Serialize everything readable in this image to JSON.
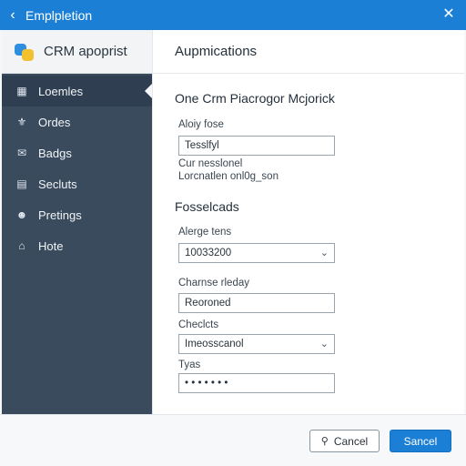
{
  "window": {
    "title": "Emplpletion",
    "back_icon": "chevron-left-icon",
    "close_icon": "close-icon"
  },
  "sidebar": {
    "brand": "CRM apoprist",
    "items": [
      {
        "label": "Loemles",
        "icon": "calendar-icon",
        "active": true
      },
      {
        "label": "Ordes",
        "icon": "flask-icon",
        "active": false
      },
      {
        "label": "Badgs",
        "icon": "mail-icon",
        "active": false
      },
      {
        "label": "Secluts",
        "icon": "document-icon",
        "active": false
      },
      {
        "label": "Pretings",
        "icon": "user-icon",
        "active": false
      },
      {
        "label": "Hote",
        "icon": "home-icon",
        "active": false
      }
    ]
  },
  "main": {
    "header": "Aupmications",
    "section1_title": "One Crm Piacrogor Mcjorick",
    "field1_label": "Aloiy fose",
    "field1_value": "Tesslfyl",
    "note_line1": "Cur nesslonel",
    "note_line2": "Lorcnatlen onl0g_son",
    "section2_title": "Fosselcads",
    "field2_label": "Alerge tens",
    "field2_value": "10033200",
    "field3_label": "Charnse rleday",
    "field3_value": "Reoroned",
    "field4_label": "Checlcts",
    "field4_value": "Imeosscanol",
    "field5_label": "Tyas",
    "field5_value": "• • • • • • •"
  },
  "footer": {
    "cancel_label": "Cancel",
    "primary_label": "Sancel"
  },
  "colors": {
    "accent": "#1b7fd6",
    "sidebar": "#3a4b5e"
  }
}
